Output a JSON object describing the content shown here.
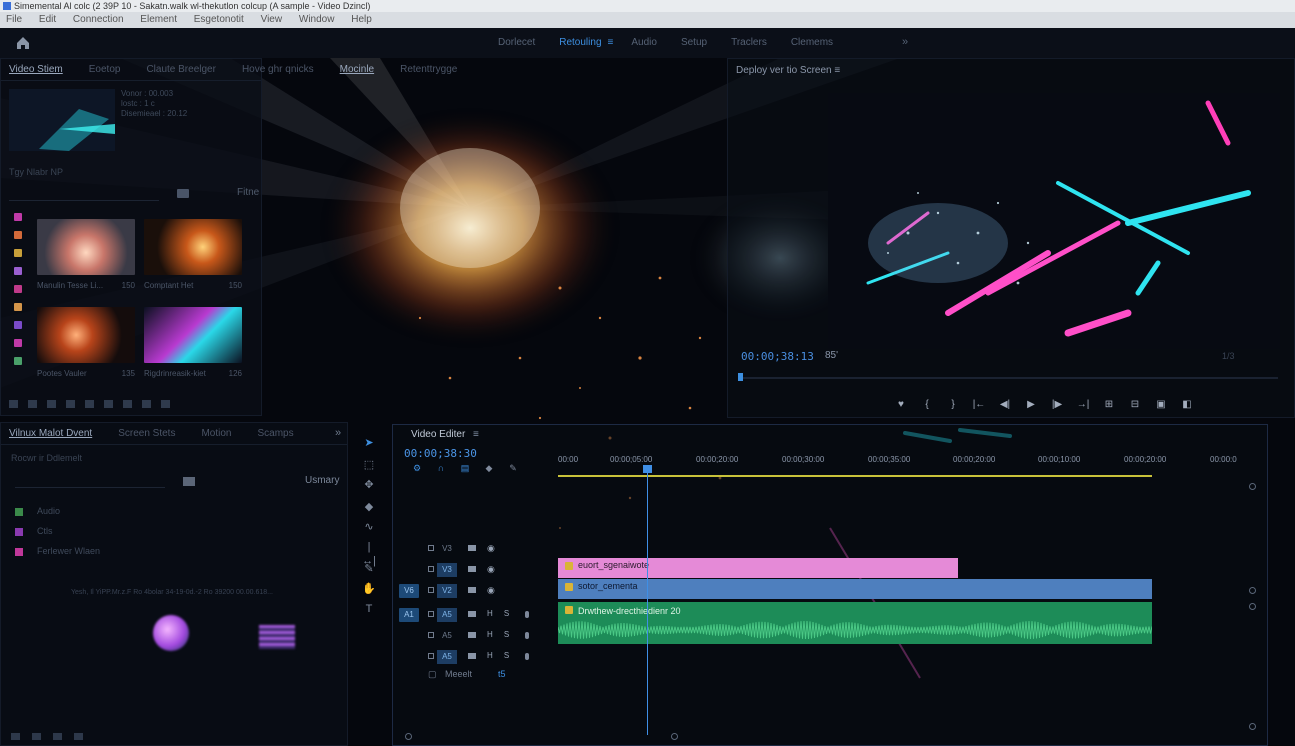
{
  "window": {
    "title": "Simemental Al colc (2 39P 10 - Sakatn.walk wl-thekutlon colcup (A sample - Video Dzincl)"
  },
  "menu": [
    "File",
    "Edit",
    "Connection",
    "Element",
    "Esgetonotit",
    "View",
    "Window",
    "Help"
  ],
  "workspaces": {
    "tabs": [
      "Dorlecet",
      "Retouling",
      "Audio",
      "Setup",
      "Traclers",
      "Clemems"
    ],
    "active": "Retouling",
    "more": "»"
  },
  "media_panel": {
    "tabs": [
      "Video Stiem",
      "Eoetop",
      "Claute Breelger",
      "Hove ghr qnicks",
      "Mocinle",
      "Retenttrygge"
    ],
    "active_tab": "Mocinle",
    "meta_lines": [
      "Vonor : 00.003",
      "lostc : 1 c",
      "Disemieael : 20.12"
    ],
    "subline": "Tgy    Nlabr NP",
    "filter_label": "Fitne",
    "swatch_colors": [
      "#c03aa8",
      "#d36a3a",
      "#c8a03a",
      "#9a5fd0",
      "#c03a8a",
      "#d4954a",
      "#7a4bc8",
      "#c03aa8",
      "#4aa06a"
    ],
    "items": [
      {
        "name": "Manulin Tesse Li...",
        "value": "150",
        "hue": "fire"
      },
      {
        "name": "Comptant Het",
        "value": "150",
        "hue": "ember"
      },
      {
        "name": "Pootes Vauler",
        "value": "135",
        "hue": "burst"
      },
      {
        "name": "Rigdrinreasik-kiet",
        "value": "126",
        "hue": "neon"
      }
    ]
  },
  "program_monitor": {
    "title": "Deploy ver tio Screen",
    "timecode": "00:00;38:13",
    "fit": "85'",
    "resolution": "1/3",
    "controls": [
      "marker-icon",
      "in-icon",
      "out-icon",
      "goto-in-icon",
      "step-back-icon",
      "play-icon",
      "step-forward-icon",
      "goto-out-icon",
      "insert-icon",
      "overwrite-icon",
      "export-frame-icon",
      "compare-icon"
    ]
  },
  "effects_panel": {
    "tabs": [
      "Vilnux Malot Dvent",
      "Screen Stets",
      "Motion",
      "Scamps"
    ],
    "more": "»",
    "search_placeholder": "Rocwr ir Ddlemelt",
    "usage_label": "Usmary",
    "tree": [
      {
        "label": "Audio",
        "color": "#3b8a4a"
      },
      {
        "label": "Ctls",
        "color": "#8a3ab0"
      },
      {
        "label": "Ferlewer Wlaen",
        "color": "#c0389a"
      }
    ],
    "detail_line": "Yesh, Il YiPP.Mr.z.F     Ro     4bolar 34-19-0d.-2     Ro     39200 00.00.618..."
  },
  "timeline": {
    "title": "Video Editer",
    "timecode": "00:00;38:30",
    "ruler": [
      "00:00",
      "00:00;05:00",
      "00:00;20:00",
      "00:00;30:00",
      "00:00;35:00",
      "00:00;20:00",
      "00:00;10:00",
      "00:00;20:00",
      "00:00:0"
    ],
    "tracks": [
      {
        "label": "V3",
        "type": "video",
        "targeted": false
      },
      {
        "label": "V3",
        "type": "video",
        "targeted": true
      },
      {
        "label": "V2",
        "type": "video",
        "targeted": true,
        "toggle": "V6"
      },
      {
        "label": "A5",
        "type": "audio",
        "targeted": true,
        "toggle": "A1"
      },
      {
        "label": "A5",
        "type": "audio",
        "targeted": false
      },
      {
        "label": "A5",
        "type": "audio",
        "targeted": false
      }
    ],
    "master_label": "Meeelt",
    "master_value": "t5",
    "clips": {
      "video2": "euort_sgenaiwote",
      "video1": "sotor_cementa",
      "audio": "Drwthew-drecthiedienr 20"
    }
  },
  "colors": {
    "accent": "#3d8fe0",
    "clip_pink": "#e58ad7",
    "clip_blue": "#4e7fbe",
    "clip_green": "#1d8c58",
    "work_area": "#c8c23a"
  }
}
